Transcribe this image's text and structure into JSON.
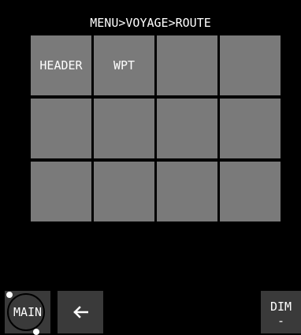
{
  "breadcrumb": "MENU>VOYAGE>ROUTE",
  "tiles": [
    {
      "label": "HEADER"
    },
    {
      "label": "WPT"
    },
    {
      "label": ""
    },
    {
      "label": ""
    },
    {
      "label": ""
    },
    {
      "label": ""
    },
    {
      "label": ""
    },
    {
      "label": ""
    },
    {
      "label": ""
    },
    {
      "label": ""
    },
    {
      "label": ""
    },
    {
      "label": ""
    }
  ],
  "bottom_bar": {
    "main_label": "MAIN",
    "back_icon": "arrow-left-icon",
    "dim_label": "DIM",
    "dim_value": "-"
  },
  "colors": {
    "background": "#000000",
    "tile": "#7a7a7a",
    "button": "#3a3a3a",
    "text": "#ffffff"
  }
}
